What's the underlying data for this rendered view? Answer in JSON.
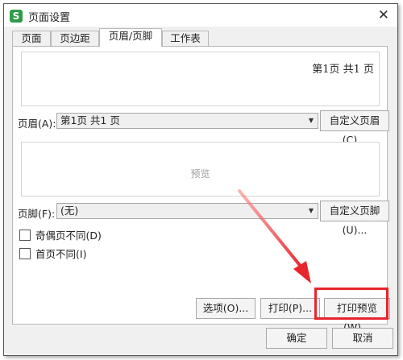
{
  "window": {
    "title": "页面设置",
    "icon_letter": "S"
  },
  "tabs": [
    {
      "label": "页面"
    },
    {
      "label": "页边距"
    },
    {
      "label": "页眉/页脚"
    },
    {
      "label": "工作表"
    }
  ],
  "header": {
    "preview_text": "第1页  共1  页",
    "label": "页眉(A):",
    "value": "第1页 共1 页",
    "custom_button": "自定义页眉(C)..."
  },
  "footer": {
    "preview_text": "预览",
    "label": "页脚(F):",
    "value": "(无)",
    "custom_button": "自定义页脚(U)..."
  },
  "options": {
    "odd_even_label": "奇偶页不同(D)",
    "first_page_label": "首页不同(I)"
  },
  "buttons": {
    "options": "选项(O)...",
    "print": "打印(P)...",
    "print_preview": "打印预览(W)...",
    "ok": "确定",
    "cancel": "取消"
  },
  "colors": {
    "highlight": "#e8242c",
    "brand": "#2e9b48"
  }
}
